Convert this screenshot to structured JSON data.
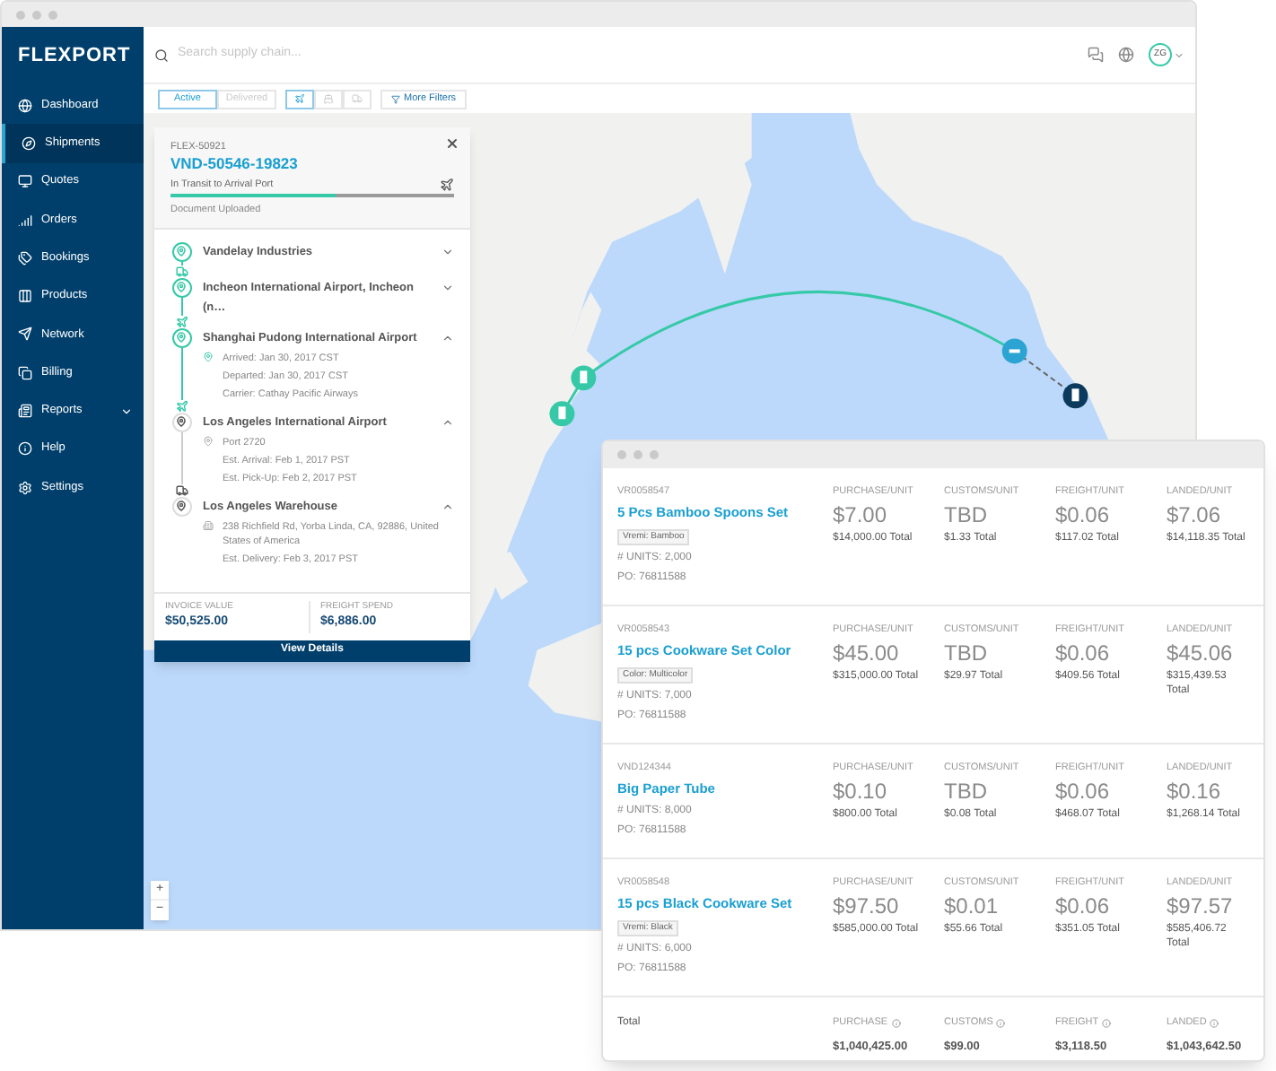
{
  "sidebar": {
    "logo": "FLEXPORT",
    "items": [
      {
        "label": "Dashboard",
        "selected": false,
        "menu": false
      },
      {
        "label": "Shipments",
        "selected": true,
        "menu": false
      },
      {
        "label": "Quotes",
        "selected": false,
        "menu": false
      },
      {
        "label": "Orders",
        "selected": false,
        "menu": false
      },
      {
        "label": "Bookings",
        "selected": false,
        "menu": false
      },
      {
        "label": "Products",
        "selected": false,
        "menu": false
      },
      {
        "label": "Network",
        "selected": false,
        "menu": false
      },
      {
        "label": "Billing",
        "selected": false,
        "menu": false
      },
      {
        "label": "Reports",
        "selected": false,
        "menu": true
      },
      {
        "label": "Help",
        "selected": false,
        "menu": false
      },
      {
        "label": "Settings",
        "selected": false,
        "menu": false
      }
    ]
  },
  "search": {
    "placeholder": "Search supply chain..."
  },
  "user": {
    "initials": "ZG"
  },
  "filters": [
    {
      "label": "Active",
      "selected": true
    },
    {
      "label": "Delivered",
      "selected": false
    }
  ],
  "modes": [
    {
      "kind": "plane",
      "selected": true
    },
    {
      "kind": "ship",
      "selected": false
    },
    {
      "kind": "truck",
      "selected": false
    }
  ],
  "more_filters": "More Filters",
  "zoom": {
    "in": "+",
    "out": "−"
  },
  "shipment": {
    "id": "FLEX-50921",
    "reference": "VND-50546-19823",
    "status": "In Transit to Arrival Port",
    "level": 0.58,
    "note": "Document Uploaded",
    "stops": [
      {
        "name": "Vandelay Industries",
        "done": true,
        "expanded": false,
        "leg": {
          "kind": "truck"
        }
      },
      {
        "name": "Incheon International Airport, Incheon (n…",
        "done": true,
        "expanded": false,
        "leg": {
          "kind": "plane"
        }
      },
      {
        "name": "Shanghai Pudong International Airport",
        "done": true,
        "expanded": true,
        "leg": {
          "kind": "plane"
        },
        "details": [
          {
            "kind": "port",
            "text": "Arrived: Jan 30, 2017 CST"
          },
          {
            "kind": "plain",
            "text": "Departed: Jan 30, 2017 CST"
          },
          {
            "kind": "plain",
            "text": "Carrier: Cathay Pacific Airways"
          }
        ]
      },
      {
        "name": "Los Angeles International Airport",
        "done": false,
        "expanded": true,
        "leg": {
          "kind": "truck"
        },
        "details": [
          {
            "kind": "port",
            "text": "Port 2720"
          },
          {
            "kind": "plain",
            "text": "Est. Arrival: Feb 1, 2017 PST"
          },
          {
            "kind": "plain",
            "text": "Est. Pick-Up: Feb 2, 2017 PST"
          }
        ]
      },
      {
        "name": "Los Angeles Warehouse",
        "done": false,
        "expanded": true,
        "details": [
          {
            "kind": "address",
            "text": "238 Richfield Rd, Yorba Linda, CA, 92886, United States of America"
          },
          {
            "kind": "plain",
            "text": "Est. Delivery: Feb 3, 2017 PST"
          }
        ]
      }
    ],
    "invoice": {
      "label": "INVOICE VALUE",
      "value": "$50,525.00"
    },
    "freight": {
      "label": "FREIGHT SPEND",
      "value": "$6,886.00"
    },
    "button": "View Details"
  },
  "products": [
    {
      "code": "VR0058547",
      "name": "5 Pcs Bamboo Spoons Set",
      "tag": "Vremi: Bamboo",
      "units": "# UNITS: 2,000",
      "po": "PO: 76811588",
      "cells": [
        {
          "label": "PURCHASE/UNIT",
          "unit": "$7.00",
          "total": "$14,000.00 Total"
        },
        {
          "label": "CUSTOMS/UNIT",
          "unit": "TBD",
          "total": "$1.33 Total"
        },
        {
          "label": "FREIGHT/UNIT",
          "unit": "$0.06",
          "total": "$117.02 Total"
        },
        {
          "label": "LANDED/UNIT",
          "unit": "$7.06",
          "total": "$14,118.35 Total"
        }
      ]
    },
    {
      "code": "VR0058543",
      "name": "15 pcs Cookware Set Color",
      "tag": "Color: Multicolor",
      "units": "# UNITS: 7,000",
      "po": "PO: 76811588",
      "cells": [
        {
          "label": "PURCHASE/UNIT",
          "unit": "$45.00",
          "total": "$315,000.00 Total"
        },
        {
          "label": "CUSTOMS/UNIT",
          "unit": "TBD",
          "total": "$29.97 Total"
        },
        {
          "label": "FREIGHT/UNIT",
          "unit": "$0.06",
          "total": "$409.56 Total"
        },
        {
          "label": "LANDED/UNIT",
          "unit": "$45.06",
          "total": "$315,439.53 Total"
        }
      ]
    },
    {
      "code": "VND124344",
      "name": "Big Paper Tube",
      "units": "# UNITS: 8,000",
      "po": "PO: 76811588",
      "cells": [
        {
          "label": "PURCHASE/UNIT",
          "unit": "$0.10",
          "total": "$800.00 Total"
        },
        {
          "label": "CUSTOMS/UNIT",
          "unit": "TBD",
          "total": "$0.08 Total"
        },
        {
          "label": "FREIGHT/UNIT",
          "unit": "$0.06",
          "total": "$468.07 Total"
        },
        {
          "label": "LANDED/UNIT",
          "unit": "$0.16",
          "total": "$1,268.14 Total"
        }
      ]
    },
    {
      "code": "VR0058548",
      "name": "15 pcs Black Cookware Set",
      "tag": "Vremi: Black",
      "units": "# UNITS: 6,000",
      "po": "PO: 76811588",
      "cells": [
        {
          "label": "PURCHASE/UNIT",
          "unit": "$97.50",
          "total": "$585,000.00 Total"
        },
        {
          "label": "CUSTOMS/UNIT",
          "unit": "$0.01",
          "total": "$55.66 Total"
        },
        {
          "label": "FREIGHT/UNIT",
          "unit": "$0.06",
          "total": "$351.05 Total"
        },
        {
          "label": "LANDED/UNIT",
          "unit": "$97.57",
          "total": "$585,406.72 Total"
        }
      ]
    }
  ],
  "totals": {
    "label": "Total",
    "cells": [
      {
        "label": "PURCHASE",
        "value": "$1,040,425.00"
      },
      {
        "label": "CUSTOMS",
        "value": "$99.00"
      },
      {
        "label": "FREIGHT",
        "value": "$3,118.50"
      },
      {
        "label": "LANDED",
        "value": "$1,043,642.50"
      }
    ]
  }
}
